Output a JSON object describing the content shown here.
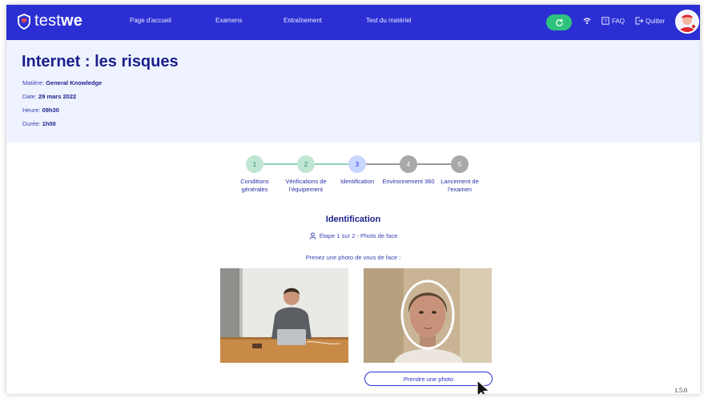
{
  "app": {
    "brand_light": "test",
    "brand_bold": "we",
    "colors": {
      "primary": "#2b2fd3",
      "title": "#1c1f8c",
      "success": "#2ec27e",
      "header_bg": "#eef3ff"
    }
  },
  "nav": {
    "items": [
      "Page d'accueil",
      "Examens",
      "Entraînement",
      "Test du matériel"
    ],
    "faq": "FAQ",
    "quit": "Quitter",
    "icons": [
      "sync-icon",
      "wifi-icon",
      "faq-icon",
      "logout-icon"
    ]
  },
  "exam": {
    "title": "Internet : les risques",
    "subject_label": "Matière:",
    "subject": "General Knowledge",
    "date_label": "Date:",
    "date": "29 mars 2022",
    "time_label": "Heure:",
    "time": "09h30",
    "duration_label": "Durée:",
    "duration": "1h00"
  },
  "stepper": {
    "steps": [
      {
        "number": "1",
        "label": "Conditions générales",
        "state": "done"
      },
      {
        "number": "2",
        "label": "Vérifications de l'équipement",
        "state": "done"
      },
      {
        "number": "3",
        "label": "Identification",
        "state": "current"
      },
      {
        "number": "4",
        "label": "Environnement 360",
        "state": "pending"
      },
      {
        "number": "5",
        "label": "Lancement de l'examen",
        "state": "pending"
      }
    ]
  },
  "identification": {
    "title": "Identification",
    "substep": "Étape 1 sur 2 - Photo de face",
    "instruction": "Prenez une photo de vous de face :",
    "button": "Prendre une photo"
  },
  "version": "1.5.0"
}
